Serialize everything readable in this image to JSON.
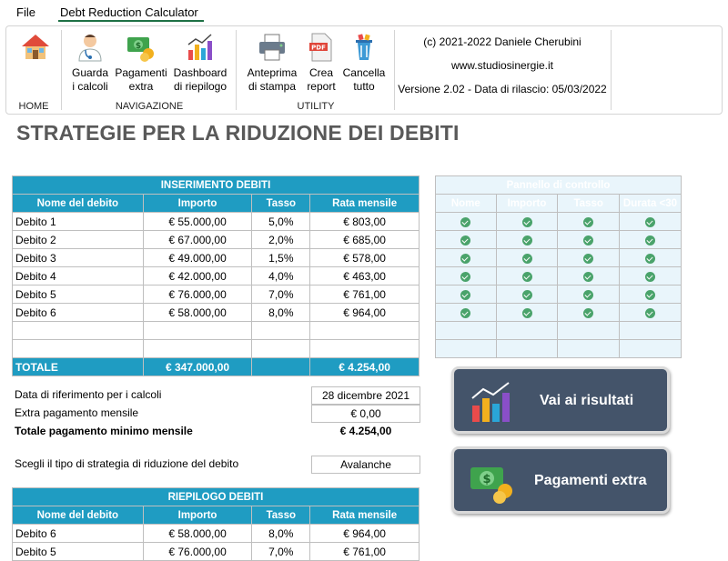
{
  "menu": {
    "file": "File",
    "active_tab": "Debt Reduction Calculator"
  },
  "ribbon": {
    "home": {
      "label": "HOME"
    },
    "nav": {
      "group_label": "NAVIGAZIONE",
      "buttons": [
        {
          "line1": "Guarda",
          "line2": "i calcoli"
        },
        {
          "line1": "Pagamenti",
          "line2": "extra"
        },
        {
          "line1": "Dashboard",
          "line2": "di riepilogo"
        }
      ]
    },
    "utility": {
      "group_label": "UTILITY",
      "buttons": [
        {
          "line1": "Anteprima",
          "line2": "di stampa"
        },
        {
          "line1": "Crea",
          "line2": "report"
        },
        {
          "line1": "Cancella",
          "line2": "tutto"
        }
      ]
    },
    "info": {
      "copyright": "(c) 2021-2022 Daniele Cherubini",
      "website": "www.studiosinergie.it",
      "version": "Versione 2.02 - Data di rilascio: 05/03/2022"
    }
  },
  "sheet": {
    "title": "STRATEGIE PER LA RIDUZIONE DEI DEBITI",
    "input_table": {
      "title": "INSERIMENTO DEBITI",
      "headers": [
        "Nome del debito",
        "Importo",
        "Tasso",
        "Rata mensile"
      ],
      "rows": [
        [
          "Debito 1",
          "€ 55.000,00",
          "5,0%",
          "€ 803,00"
        ],
        [
          "Debito 2",
          "€ 67.000,00",
          "2,0%",
          "€ 685,00"
        ],
        [
          "Debito 3",
          "€ 49.000,00",
          "1,5%",
          "€ 578,00"
        ],
        [
          "Debito 4",
          "€ 42.000,00",
          "4,0%",
          "€ 463,00"
        ],
        [
          "Debito 5",
          "€ 76.000,00",
          "7,0%",
          "€ 761,00"
        ],
        [
          "Debito 6",
          "€ 58.000,00",
          "8,0%",
          "€ 964,00"
        ]
      ],
      "total_label": "TOTALE",
      "total_amount": "€ 347.000,00",
      "total_rate": "€ 4.254,00"
    },
    "control_panel": {
      "title": "Pannello di controllo",
      "headers": [
        "Nome",
        "Importo",
        "Tasso",
        "Durata <30"
      ]
    },
    "params": {
      "ref_date_label": "Data di riferimento per i calcoli",
      "ref_date_value": "28 dicembre 2021",
      "extra_label": "Extra pagamento mensile",
      "extra_value": "€ 0,00",
      "min_total_label": "Totale pagamento minimo mensile",
      "min_total_value": "€ 4.254,00",
      "strategy_label": "Scegli il tipo di strategia di riduzione del debito",
      "strategy_value": "Avalanche"
    },
    "buttons": {
      "results": "Vai ai risultati",
      "extra": "Pagamenti extra"
    },
    "summary_table": {
      "title": "RIEPILOGO DEBITI",
      "headers": [
        "Nome del debito",
        "Importo",
        "Tasso",
        "Rata mensile"
      ],
      "rows": [
        [
          "Debito 6",
          "€ 58.000,00",
          "8,0%",
          "€ 964,00"
        ],
        [
          "Debito 5",
          "€ 76.000,00",
          "7,0%",
          "€ 761,00"
        ]
      ]
    }
  }
}
